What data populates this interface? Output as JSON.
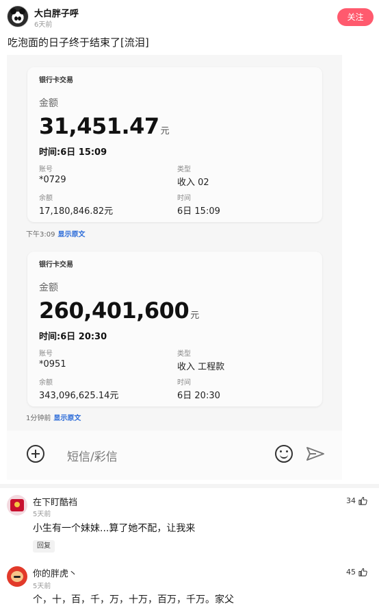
{
  "post": {
    "username": "大白胖子呼",
    "time": "6天前",
    "follow_label": "关注",
    "text": "吃泡面的日子终于结束了[流泪]"
  },
  "messages": [
    {
      "title": "银行卡交易",
      "amount_label": "金额",
      "amount": "31,451.47",
      "unit": "元",
      "time_line": "时间:6日 15:09",
      "account_label": "账号",
      "account": "*0729",
      "type_label": "类型",
      "type": "收入 02",
      "balance_label": "余额",
      "balance": "17,180,846.82元",
      "time_label": "时间",
      "time": "6日 15:09",
      "stamp": "下午3:09",
      "show_original": "显示原文"
    },
    {
      "title": "银行卡交易",
      "amount_label": "金额",
      "amount": "260,401,600",
      "unit": "元",
      "time_line": "时间:6日 20:30",
      "account_label": "账号",
      "account": "*0951",
      "type_label": "类型",
      "type": "收入 工程款",
      "balance_label": "余额",
      "balance": "343,096,625.14元",
      "time_label": "时间",
      "time": "6日 20:30",
      "stamp": "1分钟前",
      "show_original": "显示原文"
    }
  ],
  "composer": {
    "placeholder": "短信/彩信"
  },
  "comments": [
    {
      "name": "在下盯酷裆",
      "time": "5天前",
      "text": "小生有一个妹妹...算了她不配，让我来",
      "likes": "34",
      "reply_label": "回复"
    },
    {
      "name": "你的胖虎丶",
      "time": "5天前",
      "text": "个，十，百，千，万，十万，百万，千万。家父",
      "likes": "45"
    }
  ],
  "colors": {
    "follow": "#ff5a6e",
    "link": "#2a6ad8"
  }
}
